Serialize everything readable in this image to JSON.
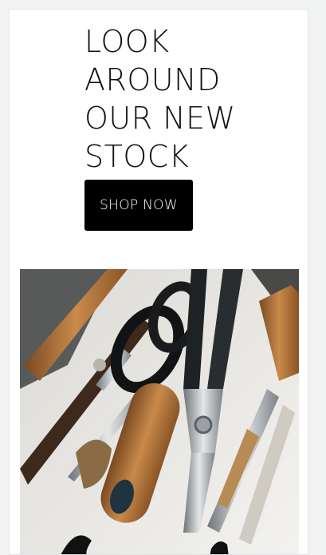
{
  "hero": {
    "headline_lines": [
      "LOOK",
      "AROUND",
      "OUR NEW",
      "STOCK"
    ],
    "cta_label": "SHOP NOW"
  },
  "image": {
    "subject": "leathercraft-tools-photo"
  },
  "colors": {
    "page_background": "#f2f3f3",
    "card_background": "#ffffff",
    "button_background": "#000000",
    "button_text": "#ffffff"
  }
}
